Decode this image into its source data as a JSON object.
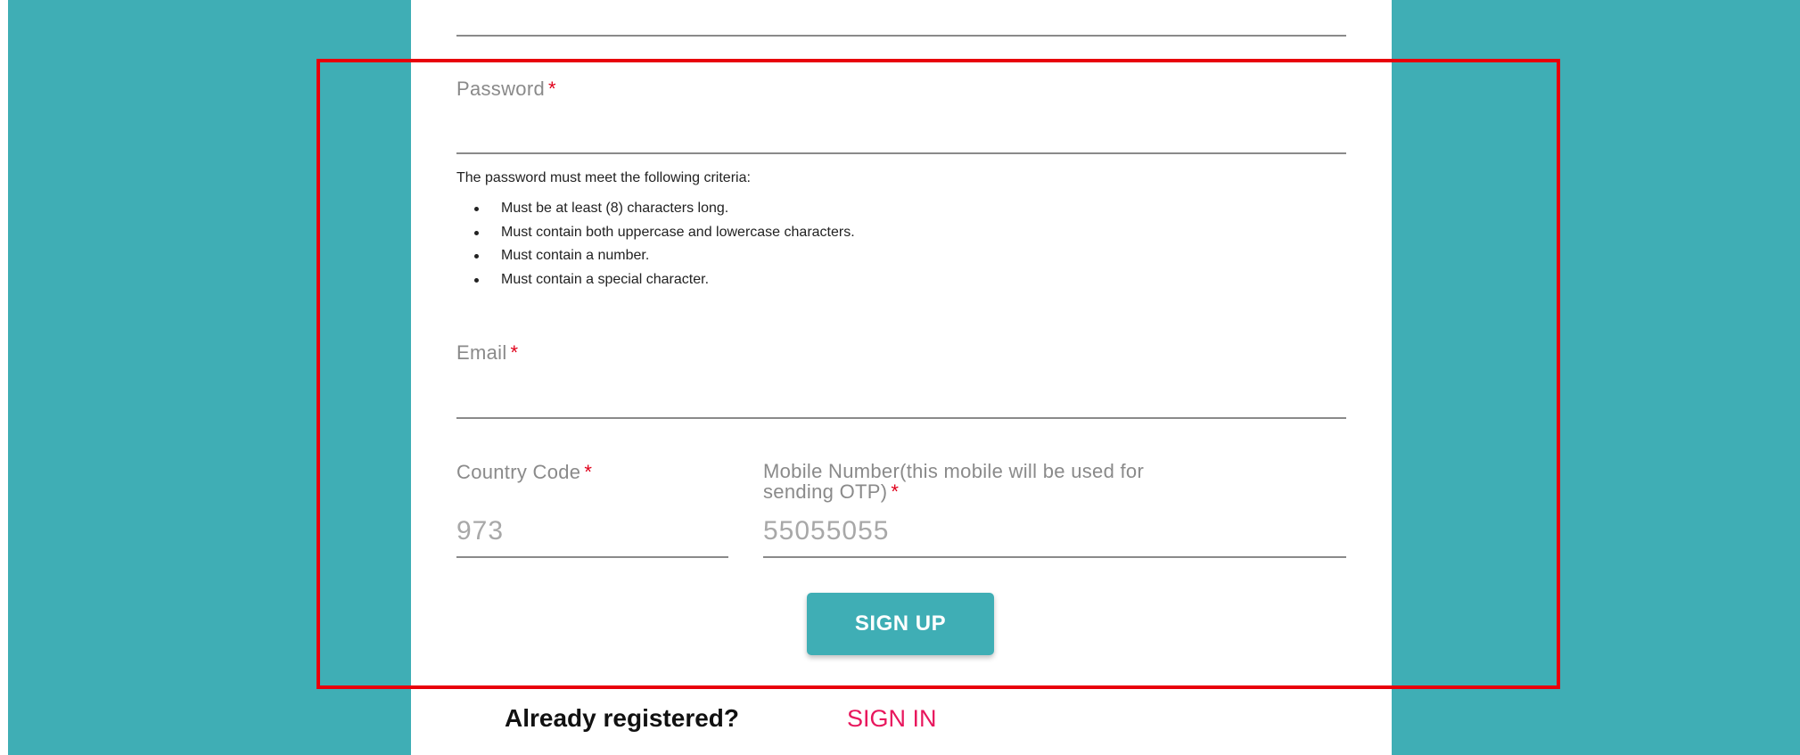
{
  "form": {
    "password": {
      "label": "Password",
      "required_mark": "*",
      "value": ""
    },
    "password_hint": {
      "title": "The password must meet the following criteria:",
      "items": [
        "Must be at least (8) characters long.",
        "Must contain both uppercase and lowercase characters.",
        "Must contain a number.",
        "Must contain a special character."
      ]
    },
    "email": {
      "label": "Email",
      "required_mark": "*",
      "value": ""
    },
    "country_code": {
      "label": "Country Code",
      "required_mark": "*",
      "placeholder": "973"
    },
    "mobile": {
      "label_line1": "Mobile Number(this mobile will be used for",
      "label_line2": "sending OTP)",
      "required_mark": "*",
      "placeholder": "55055055"
    },
    "signup_label": "SIGN UP"
  },
  "footer": {
    "already_text": "Already registered?",
    "signin_label": "SIGN IN"
  },
  "colors": {
    "teal": "#3faeb5",
    "required": "#e0001a",
    "signin_link": "#e8175d",
    "highlight": "#e8000b"
  }
}
